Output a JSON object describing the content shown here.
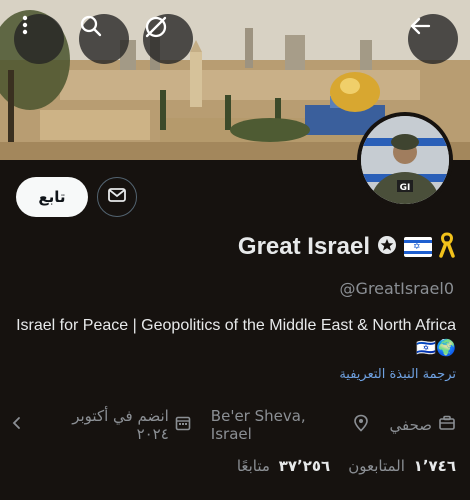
{
  "header": {
    "more_icon": "more-vertical-icon",
    "search_icon": "search-icon",
    "hide_icon": "eye-slash-icon",
    "back_icon": "arrow-left-icon"
  },
  "profile": {
    "follow_label": "تابع",
    "display_name": "Great Israel",
    "handle": "@GreatIsrael0",
    "bio": "Israel for Peace | Geopolitics of the Middle East & North Africa 🇮🇱🌍",
    "translate_bio": "ترجمة النبذة التعريفية",
    "category": "صحفي",
    "location": "Be'er Sheva, Israel",
    "joined": "انضم في أكتوبر ٢٠٢٤",
    "following_count": "١٬٧٤٦",
    "following_label": "المتابعون",
    "followers_count": "٣٧٬٢٥٦",
    "followers_label": "متابعًا"
  },
  "colors": {
    "background": "#16120f",
    "text_primary": "#e7e9ea",
    "text_secondary": "#8b8f94",
    "link": "#6ea0e0",
    "follow_button_bg": "#f7f9f9"
  }
}
